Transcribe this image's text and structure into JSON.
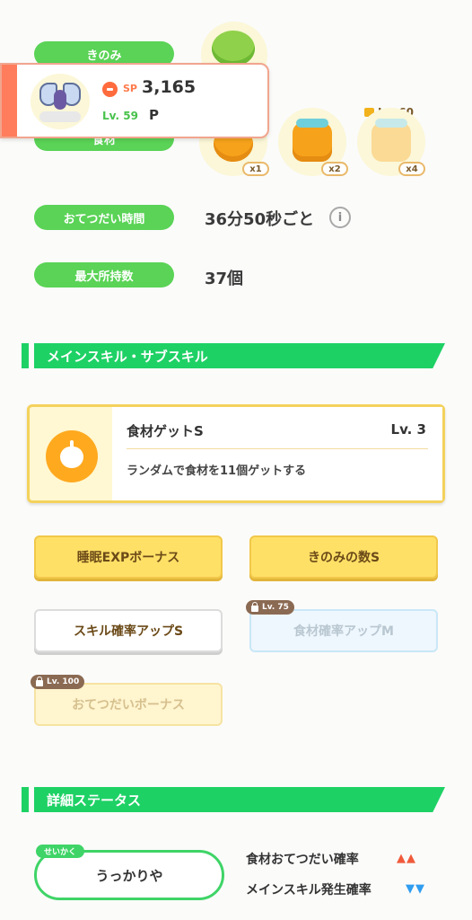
{
  "profile": {
    "berry_label": "きのみ",
    "ingredient_label": "食材",
    "help_time_label": "おてつだい時間",
    "help_time_value": "36分50秒ごと",
    "max_carry_label": "最大所持数",
    "max_carry_value": "37個"
  },
  "ingredients": [
    {
      "multiplier": "x1",
      "color": "#f7a21b"
    },
    {
      "multiplier": "x2",
      "color": "#f7a21b"
    },
    {
      "multiplier": "x4",
      "color": "#fbd58a",
      "lock_label": "Lv. 60"
    }
  ],
  "pokemon_card": {
    "sp_label": "SP",
    "sp_value": "3,165",
    "level": "Lv. 59",
    "trailing": "P"
  },
  "skills_section": {
    "title": "メインスキル・サブスキル"
  },
  "main_skill": {
    "name": "食材ゲットS",
    "level": "Lv. 3",
    "description": "ランダムで食材を11個ゲットする",
    "icon": "apple-icon"
  },
  "sub_skills": [
    {
      "label": "睡眠EXPボーナス",
      "style": "gold"
    },
    {
      "label": "きのみの数S",
      "style": "gold"
    },
    {
      "label": "スキル確率アップS",
      "style": "white"
    },
    {
      "label": "食材確率アップM",
      "style": "blue",
      "lock": "Lv. 75"
    },
    {
      "label": "おてつだいボーナス",
      "style": "paleGold",
      "lock": "Lv. 100"
    }
  ],
  "details_section": {
    "title": "詳細ステータス"
  },
  "nature": {
    "tag": "せいかく",
    "value": "うっかりや"
  },
  "nature_effects": [
    {
      "label": "食材おてつだい確率",
      "direction": "up",
      "arrows": "▲▲",
      "color": "#f05a3b"
    },
    {
      "label": "メインスキル発生確率",
      "direction": "down",
      "arrows": "▼▼",
      "color": "#2f9df0"
    }
  ]
}
